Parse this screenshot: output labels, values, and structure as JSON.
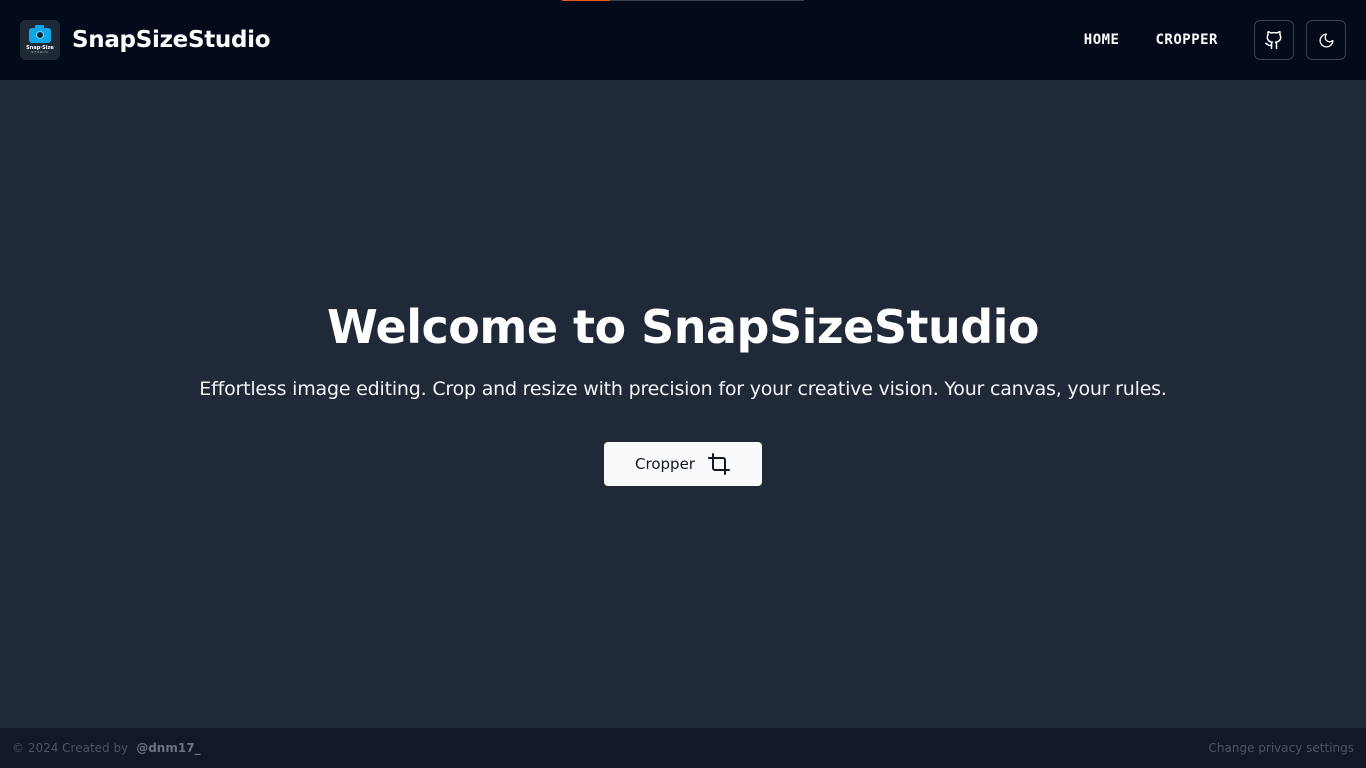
{
  "progress": {
    "fraction": 0.2,
    "color": "#ea580c"
  },
  "header": {
    "brand_name": "SnapSizeStudio",
    "logo_text": "Snap·Size",
    "logo_subtext": "STUDIO",
    "nav": [
      {
        "label": "HOME"
      },
      {
        "label": "CROPPER"
      }
    ],
    "github_icon": "github-icon",
    "theme_icon": "moon-icon"
  },
  "hero": {
    "title": "Welcome to SnapSizeStudio",
    "subtitle": "Effortless image editing. Crop and resize with precision for your creative vision. Your canvas, your rules.",
    "cta_label": "Cropper",
    "cta_icon": "crop-icon"
  },
  "footer": {
    "copyright": "© 2024 Created by",
    "author": "@dnm17_",
    "privacy": "Change privacy settings"
  },
  "colors": {
    "header_bg": "#030a1a",
    "main_bg": "#1f2937",
    "footer_bg": "#111827",
    "accent": "#0ea5e9"
  }
}
